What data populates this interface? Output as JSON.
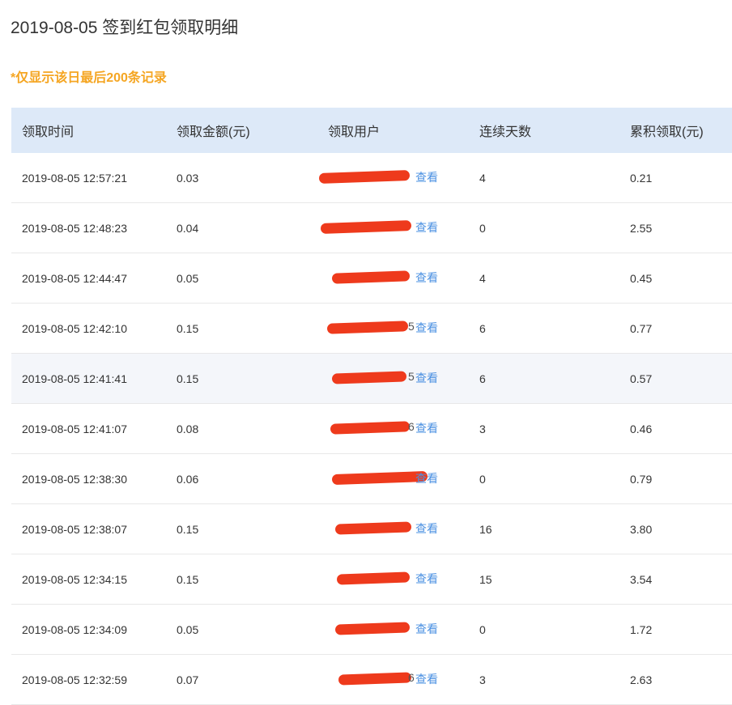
{
  "title": "2019-08-05 签到红包领取明细",
  "note": "*仅显示该日最后200条记录",
  "columns": [
    "领取时间",
    "领取金额(元)",
    "领取用户",
    "连续天数",
    "累积领取(元)"
  ],
  "view_label": "查看",
  "colors": {
    "header_bg": "#dde9f8",
    "note": "#f5a623",
    "link": "#4a90e2",
    "redaction": "#ee3a1c"
  },
  "rows": [
    {
      "time": "2019-08-05 12:57:21",
      "amount": "0.03",
      "days": "4",
      "total": "0.21",
      "user_tail": ""
    },
    {
      "time": "2019-08-05 12:48:23",
      "amount": "0.04",
      "days": "0",
      "total": "2.55",
      "user_tail": ""
    },
    {
      "time": "2019-08-05 12:44:47",
      "amount": "0.05",
      "days": "4",
      "total": "0.45",
      "user_tail": ""
    },
    {
      "time": "2019-08-05 12:42:10",
      "amount": "0.15",
      "days": "6",
      "total": "0.77",
      "user_tail": "5"
    },
    {
      "time": "2019-08-05 12:41:41",
      "amount": "0.15",
      "days": "6",
      "total": "0.57",
      "user_tail": "5"
    },
    {
      "time": "2019-08-05 12:41:07",
      "amount": "0.08",
      "days": "3",
      "total": "0.46",
      "user_tail": "6"
    },
    {
      "time": "2019-08-05 12:38:30",
      "amount": "0.06",
      "days": "0",
      "total": "0.79",
      "user_tail": ""
    },
    {
      "time": "2019-08-05 12:38:07",
      "amount": "0.15",
      "days": "16",
      "total": "3.80",
      "user_tail": ""
    },
    {
      "time": "2019-08-05 12:34:15",
      "amount": "0.15",
      "days": "15",
      "total": "3.54",
      "user_tail": ""
    },
    {
      "time": "2019-08-05 12:34:09",
      "amount": "0.05",
      "days": "0",
      "total": "1.72",
      "user_tail": ""
    },
    {
      "time": "2019-08-05 12:32:59",
      "amount": "0.07",
      "days": "3",
      "total": "2.63",
      "user_tail": "6"
    }
  ]
}
